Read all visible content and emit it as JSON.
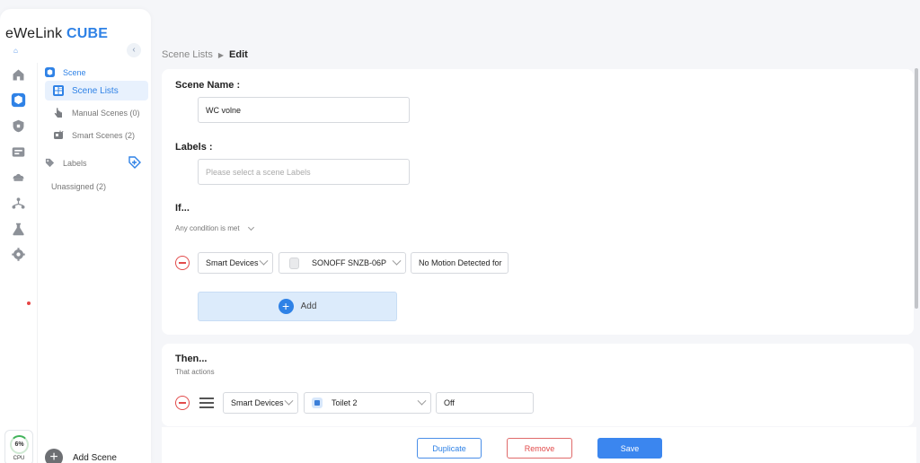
{
  "app": {
    "name_part1": "eWeLink ",
    "name_part2": "CUBE",
    "sub_glyph": "⌂"
  },
  "colors": {
    "accent": "#2f82e6",
    "danger": "#e24b4b",
    "save": "#3b86ef"
  },
  "rail": {
    "icons": [
      "home-icon",
      "scene-cube-icon",
      "shield-icon",
      "device-panel-icon",
      "cloud-icon",
      "network-icon",
      "lab-flask-icon",
      "settings-gear-icon"
    ],
    "cpu": {
      "value": "6%",
      "label": "CPU"
    }
  },
  "sidebar": {
    "scene_section": "Scene",
    "items": [
      {
        "label": "Scene Lists",
        "icon": "grid-list-icon"
      },
      {
        "label": "Manual Scenes (0)",
        "icon": "hand-tap-icon"
      },
      {
        "label": "Smart Scenes (2)",
        "icon": "smart-scene-icon"
      }
    ],
    "labels_section": "Labels",
    "unassigned": "Unassigned (2)",
    "add_scene": "Add Scene"
  },
  "breadcrumb": {
    "parent": "Scene Lists",
    "current": "Edit"
  },
  "form": {
    "scene_name_label": "Scene Name :",
    "scene_name_value": "WC volne",
    "labels_label": "Labels :",
    "labels_placeholder": "Please select a scene Labels",
    "if_label": "If...",
    "condition_mode": "Any condition is met",
    "condition": {
      "source": "Smart Devices",
      "device": "SONOFF SNZB-06P",
      "state": "No Motion Detected for"
    },
    "add_label": "Add",
    "then_label": "Then...",
    "then_sub": "That actions",
    "action": {
      "source": "Smart Devices",
      "device": "Toilet 2",
      "state": "Off"
    }
  },
  "buttons": {
    "duplicate": "Duplicate",
    "remove": "Remove",
    "save": "Save"
  }
}
